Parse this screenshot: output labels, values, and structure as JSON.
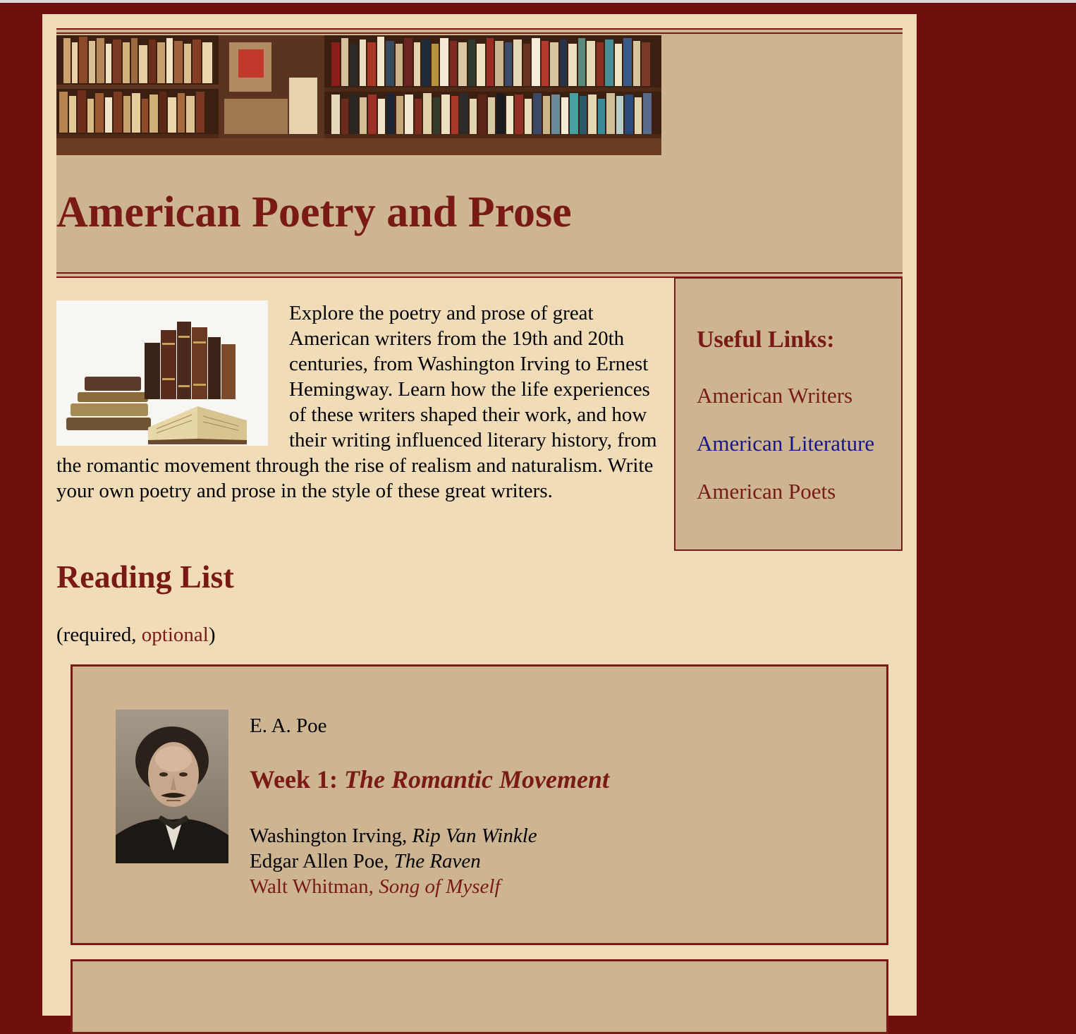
{
  "site": {
    "title": "American Poetry and Prose"
  },
  "intro": {
    "text": "Explore the poetry and prose of great American writers from the 19th and 20th centuries, from Washington Irving to Ernest Hemingway. Learn how the life experiences of these writers shaped their work, and how their writing influenced literary history, from the romantic movement through the rise of realism and naturalism. Write your own poetry and prose in the style of these great writers."
  },
  "sidebar": {
    "heading": "Useful Links:",
    "links": [
      {
        "label": "American Writers",
        "color": "#7a1a14"
      },
      {
        "label": "American Literature",
        "color": "#16168a"
      },
      {
        "label": "American Poets",
        "color": "#7a1a14"
      }
    ]
  },
  "reading_list": {
    "title": "Reading List",
    "legend_open": "(required, ",
    "legend_optional": "optional",
    "legend_close": ")",
    "weeks": [
      {
        "author_caption": "E. A. Poe",
        "week_label": "Week 1: ",
        "theme": "The Romantic Movement",
        "items": [
          {
            "author": "Washington Irving, ",
            "work": "Rip Van Winkle",
            "optional": false
          },
          {
            "author": "Edgar Allen Poe, ",
            "work": "The Raven",
            "optional": false
          },
          {
            "author": "Walt Whitman, ",
            "work": "Song of Myself",
            "optional": true
          }
        ]
      }
    ]
  },
  "colors": {
    "background": "#70100c",
    "page": "#f1dcb8",
    "panel": "#cdb591",
    "accent": "#7a1a14",
    "visited_link": "#16168a"
  }
}
